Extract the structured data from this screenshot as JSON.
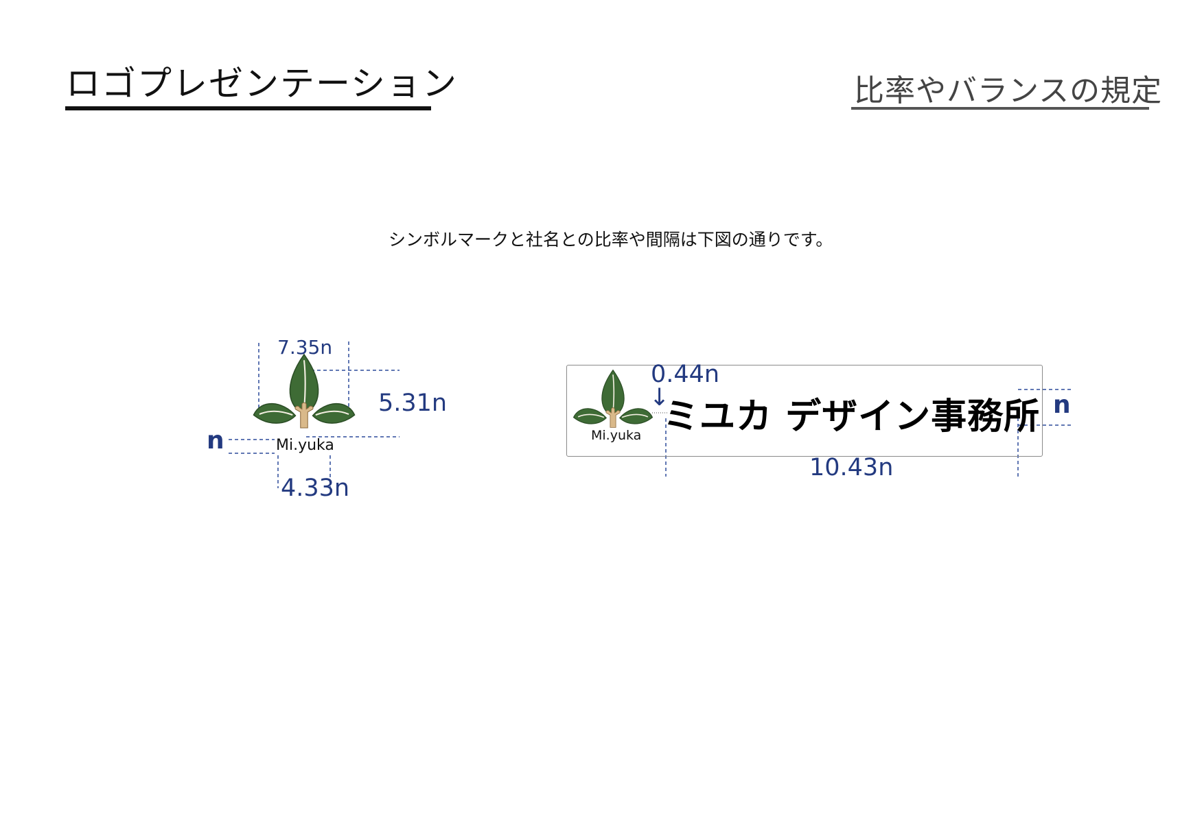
{
  "header": {
    "title": "ロゴプレゼンテーション",
    "section_title": "比率やバランスの規定"
  },
  "intro_text": "シンボルマークと社名との比率や間隔は下図の通りです。",
  "colors": {
    "leaf": "#3e6b35",
    "trunk": "#d9b98a",
    "dimension": "#233a80",
    "dashed_line": "#2c4a9a"
  },
  "symbol_diagram": {
    "brand_text": "Mi.yuka",
    "dim_width": "7.35n",
    "dim_height": "5.31n",
    "dim_unit": "n",
    "dim_text_width": "4.33n"
  },
  "logotype_diagram": {
    "brand_text": "Mi.yuka",
    "company_name": "ミユカ デザイン事務所",
    "dim_gap": "0.44n",
    "gap_arrow": "↓",
    "dim_height": "n",
    "dim_width": "10.43n"
  }
}
